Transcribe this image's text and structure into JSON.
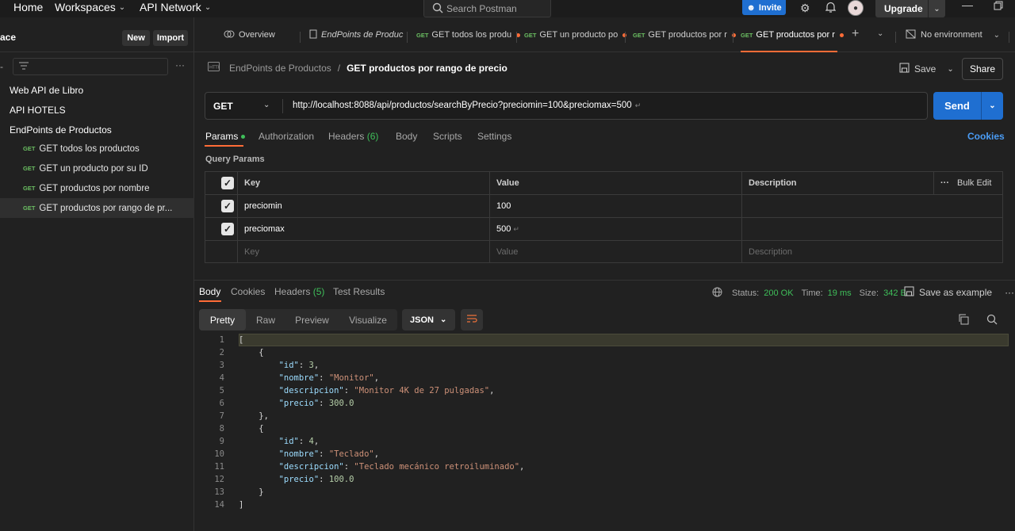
{
  "topbar": {
    "nav": [
      "Home",
      "Workspaces",
      "API Network"
    ],
    "search_placeholder": "Search Postman",
    "invite": "Invite",
    "upgrade": "Upgrade"
  },
  "sidebar": {
    "title": "ace",
    "new_label": "New",
    "import_label": "Import",
    "collections": [
      "Web API de Libro",
      "API HOTELS",
      "EndPoints de Productos"
    ],
    "requests": [
      {
        "method": "GET",
        "name": "GET todos los productos",
        "selected": false
      },
      {
        "method": "GET",
        "name": "GET un producto por su ID",
        "selected": false
      },
      {
        "method": "GET",
        "name": "GET productos por nombre",
        "selected": false
      },
      {
        "method": "GET",
        "name": "GET productos por rango de pr...",
        "selected": true
      }
    ]
  },
  "tabs": [
    {
      "label": "Overview"
    },
    {
      "label": "EndPoints de Produc"
    },
    {
      "method": "GET",
      "label": "GET todos los produ"
    },
    {
      "method": "GET",
      "label": "GET un producto po"
    },
    {
      "method": "GET",
      "label": "GET productos por r"
    },
    {
      "method": "GET",
      "label": "GET productos por r"
    }
  ],
  "environment": "No environment",
  "breadcrumb": {
    "collection": "EndPoints de Productos",
    "request": "GET productos por rango de precio"
  },
  "save_label": "Save",
  "share_label": "Share",
  "request": {
    "method": "GET",
    "url": "http://localhost:8088/api/productos/searchByPrecio?preciomin=100&preciomax=500",
    "send_label": "Send"
  },
  "request_tabs": [
    "Params",
    "Authorization",
    "Headers (6)",
    "Body",
    "Scripts",
    "Settings"
  ],
  "cookies_label": "Cookies",
  "query_params_title": "Query Params",
  "params_table": {
    "headers": [
      "Key",
      "Value",
      "Description"
    ],
    "bulk_edit": "Bulk Edit",
    "rows": [
      {
        "key": "preciomin",
        "value": "100",
        "description": ""
      },
      {
        "key": "preciomax",
        "value": "500",
        "description": ""
      }
    ],
    "placeholder": {
      "key": "Key",
      "value": "Value",
      "description": "Description"
    }
  },
  "response": {
    "tabs": [
      "Body",
      "Cookies",
      "Headers (5)",
      "Test Results"
    ],
    "status_label": "Status:",
    "status": "200 OK",
    "time_label": "Time:",
    "time": "19 ms",
    "size_label": "Size:",
    "size": "342 B",
    "save_example": "Save as example",
    "formats": [
      "Pretty",
      "Raw",
      "Preview",
      "Visualize"
    ],
    "language": "JSON",
    "lines": [
      "[",
      "    {",
      "        \"id\": 3,",
      "        \"nombre\": \"Monitor\",",
      "        \"descripcion\": \"Monitor 4K de 27 pulgadas\",",
      "        \"precio\": 300.0",
      "    },",
      "    {",
      "        \"id\": 4,",
      "        \"nombre\": \"Teclado\",",
      "        \"descripcion\": \"Teclado mecánico retroiluminado\",",
      "        \"precio\": 100.0",
      "    }",
      "]"
    ]
  },
  "colors": {
    "accent": "#ff6c37",
    "primary": "#1f6fd1",
    "method_get": "#6bbf62",
    "status_ok": "#3fbf5a"
  }
}
